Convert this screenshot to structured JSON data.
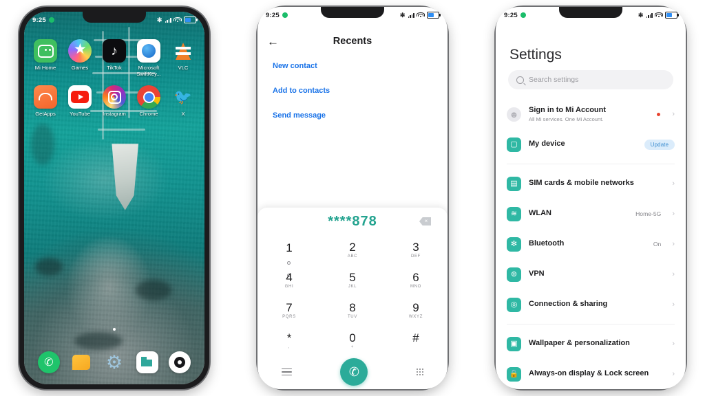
{
  "statusbar": {
    "time": "9:25",
    "bluetooth_icon": "bluetooth-icon",
    "signal_icon": "signal-icon",
    "wifi_icon": "wifi-icon",
    "battery_icon": "battery-icon"
  },
  "home": {
    "rows": [
      [
        {
          "label": "Mi Home",
          "icon": "mi-home-icon"
        },
        {
          "label": "Games",
          "icon": "games-icon"
        },
        {
          "label": "TikTok",
          "icon": "tiktok-icon"
        },
        {
          "label": "Microsoft SwiftKey...",
          "icon": "microsoft-swiftkey-icon"
        },
        {
          "label": "VLC",
          "icon": "vlc-icon"
        }
      ],
      [
        {
          "label": "GetApps",
          "icon": "getapps-icon"
        },
        {
          "label": "YouTube",
          "icon": "youtube-icon"
        },
        {
          "label": "Instagram",
          "icon": "instagram-icon"
        },
        {
          "label": "Chrome",
          "icon": "chrome-icon"
        },
        {
          "label": "X",
          "icon": "x-twitter-icon"
        }
      ]
    ],
    "dock": [
      {
        "label": "Phone",
        "icon": "phone-icon"
      },
      {
        "label": "Messages",
        "icon": "messages-icon"
      },
      {
        "label": "Settings",
        "icon": "settings-gear-icon"
      },
      {
        "label": "Gallery",
        "icon": "gallery-icon"
      },
      {
        "label": "Camera",
        "icon": "camera-icon"
      }
    ]
  },
  "dialer": {
    "title": "Recents",
    "back_icon": "back-arrow-icon",
    "links": [
      {
        "label": "New contact"
      },
      {
        "label": "Add to contacts"
      },
      {
        "label": "Send message"
      }
    ],
    "number": "****878",
    "backspace_icon": "backspace-icon",
    "keys": [
      {
        "digit": "1",
        "sub": ""
      },
      {
        "digit": "2",
        "sub": "ABC"
      },
      {
        "digit": "3",
        "sub": "DEF"
      },
      {
        "digit": "4",
        "sub": "GHI"
      },
      {
        "digit": "5",
        "sub": "JKL"
      },
      {
        "digit": "6",
        "sub": "MNO"
      },
      {
        "digit": "7",
        "sub": "PQRS"
      },
      {
        "digit": "8",
        "sub": "TUV"
      },
      {
        "digit": "9",
        "sub": "WXYZ"
      },
      {
        "digit": "*",
        "sub": ","
      },
      {
        "digit": "0",
        "sub": "+"
      },
      {
        "digit": "#",
        "sub": ""
      }
    ],
    "menu_icon": "hamburger-menu-icon",
    "call_icon": "call-icon",
    "keypad_icon": "keypad-grid-icon",
    "accent_color": "#2bab99",
    "link_color": "#1a73e8"
  },
  "settings": {
    "title": "Settings",
    "search": {
      "placeholder": "Search settings",
      "icon": "search-icon"
    },
    "account": {
      "title": "Sign in to Mi Account",
      "subtitle": "All Mi services. One Mi Account.",
      "icon": "account-avatar-icon",
      "badge": "notification-dot"
    },
    "device": {
      "title": "My device",
      "icon": "device-icon",
      "action": "Update"
    },
    "group1": [
      {
        "title": "SIM cards & mobile networks",
        "value": "",
        "icon": "sim-card-icon"
      },
      {
        "title": "WLAN",
        "value": "Home-5G",
        "icon": "wifi-icon"
      },
      {
        "title": "Bluetooth",
        "value": "On",
        "icon": "bluetooth-icon"
      },
      {
        "title": "VPN",
        "value": "",
        "icon": "vpn-globe-icon"
      },
      {
        "title": "Connection & sharing",
        "value": "",
        "icon": "connection-sharing-icon"
      }
    ],
    "group2": [
      {
        "title": "Wallpaper & personalization",
        "value": "",
        "icon": "wallpaper-icon"
      },
      {
        "title": "Always-on display & Lock screen",
        "value": "",
        "icon": "lock-screen-icon"
      }
    ],
    "accent_color": "#2fb8a4"
  }
}
